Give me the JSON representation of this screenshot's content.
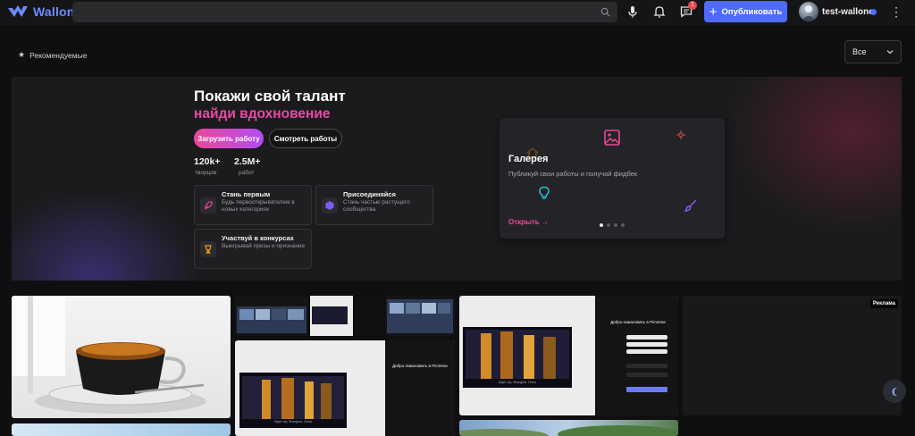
{
  "app": {
    "name": "Wallone"
  },
  "colors": {
    "brand": "#6b8bff",
    "accent": "#4f6bff",
    "pink": "#ec4899",
    "background": "#0f0f11"
  },
  "header": {
    "search_placeholder": "",
    "notifications_badge": "1",
    "publish_label": "Опубликовать",
    "username": "test-wallone",
    "icons": [
      "search-icon",
      "microphone-icon",
      "bell-icon",
      "chat-icon",
      "plus-icon",
      "kebab-menu-icon"
    ]
  },
  "filter": {
    "featured_label": "Рекомендуемые",
    "select_value": "Все"
  },
  "hero": {
    "title": "Покажи свой талант",
    "subtitle": "найди вдохновение",
    "upload_label": "Загрузить работу",
    "view_label": "Смотреть работы",
    "stats": [
      {
        "value": "120k+",
        "label": "творцов"
      },
      {
        "value": "2.5M+",
        "label": "работ"
      }
    ],
    "features": [
      {
        "title": "Стань первым",
        "description": "Будь первооткрывателем в новых категориях",
        "icon": "rocket-icon"
      },
      {
        "title": "Присоединяйся",
        "description": "Стань частью растущего сообщества",
        "icon": "community-icon"
      },
      {
        "title": "Участвуй в конкурсах",
        "description": "Выигрывай призы и признание",
        "icon": "trophy-icon"
      }
    ],
    "panel": {
      "title": "Галерея",
      "description": "Публикуй свои работы и получай фидбек",
      "open_label": "Открыть →",
      "slides": 4,
      "active_slide": 1
    }
  },
  "grid": {
    "ad_label": "Реклама",
    "login_screens": {
      "heading": "Добро пожаловать в PicVerse",
      "caption": "Night city, Shanghai, China"
    }
  }
}
